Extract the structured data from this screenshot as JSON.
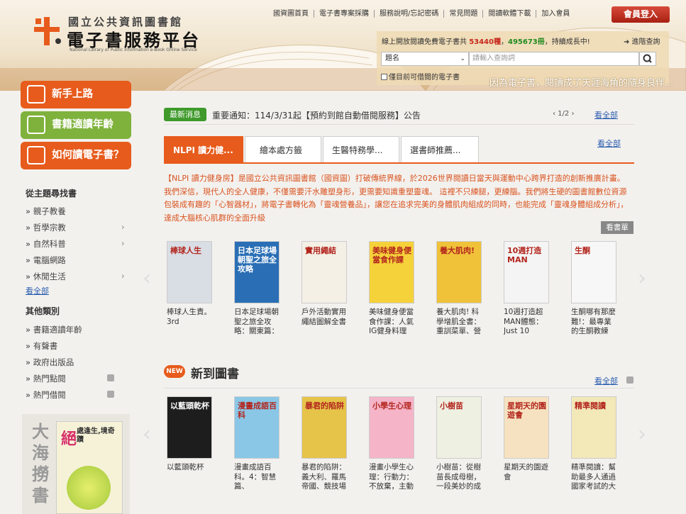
{
  "header": {
    "logo_line1": "國立公共資訊圖書館",
    "logo_line2": "電子書服務平台",
    "logo_en": "National Library of Public Information e-Book Online Service",
    "nav": [
      "國資圖首頁",
      "電子書專案採購",
      "服務說明/忘記密碼",
      "常見問題",
      "閱讀軟體下載",
      "加入會員"
    ],
    "member_login": "會員登入",
    "stat_prefix": "線上開放閱讀免費電子書共",
    "stat_titles": "53440種",
    "stat_sep": "，",
    "stat_volumes": "495673冊",
    "stat_suffix": "，持續成長中!",
    "advanced_search": "➜ 進階查詢",
    "search_field": "題名",
    "search_placeholder": "請輸入查詢詞",
    "borrowable_only": "僅目前可借閱的電子書",
    "slogan": "因為電子書，閱讀成了天涯海角的隨身良伴..."
  },
  "sidebar": {
    "beginner": "新手上路",
    "age_suitable": "書籍適讀年齡",
    "how_to_read": "如何讀電子書？",
    "topic_title": "從主題尋找書",
    "topics": [
      "親子教養",
      "哲學宗教",
      "自然科普",
      "電腦網路",
      "休閒生活"
    ],
    "see_all": "看全部",
    "other_title": "其他類別",
    "others": [
      "書籍適讀年齡",
      "有聲書",
      "政府出版品",
      "熱門點閱",
      "熱門借閱"
    ],
    "promo_big": "大海撈書",
    "promo_book_title1": "絕",
    "promo_book_title2": "處逢生,境奇蹟"
  },
  "news": {
    "tag": "最新消息",
    "text": "重要通知：114/3/31起【預約到館自動借閱服務】公告",
    "page": "‹  1/2  ›",
    "see_all": "看全部"
  },
  "tabs": {
    "items": [
      "NLPI 讀力健...",
      "繪本處方籤",
      "生醫特務學...",
      "選書師推薦..."
    ],
    "see_all": "看全部"
  },
  "feature": {
    "description": "【NLPI 讀力健身房】是國立公共資訊圖書館（國資圖）打破傳統界線，於2026世界閱讀日當天與運動中心跨界打造的創新推廣計畫。 我們深信，現代人的全人健康，不僅需要汗水雕塑身形，更需要知識重塑靈魂。 這裡不只練腿，更練腦。我們將生硬的圖書館數位資源包裝成有趣的「心智器材」，將電子書轉化為「靈魂營養品」，讓您在追求完美的身體肌肉組成的同時，也能完成「靈魂身體組成分析」，達成大腦核心肌群的全面升級",
    "read_more": "看書單",
    "books": [
      {
        "title": "棒球人生責。3rd",
        "cover": "棒球人生",
        "color": "#d9dde4"
      },
      {
        "title": "日本足球場朝聖之旅全攻略：關東篇：",
        "cover": "日本足球場朝聖之旅全攻略",
        "color": "#2a6fb5"
      },
      {
        "title": "戶外活動實用繩結圖解全書",
        "cover": "實用繩結",
        "color": "#f4f0e6"
      },
      {
        "title": "美味健身便當食作課：人氣IG健身料理",
        "cover": "美味健身便當食作課",
        "color": "#f6d23a"
      },
      {
        "title": "養大肌肉! 科學增肌全書：重訓菜單、營",
        "cover": "養大肌肉!",
        "color": "#f0c23a"
      },
      {
        "title": "10週打造超MAN體態：Just 10",
        "cover": "10週打造MAN",
        "color": "#f4f4f4"
      },
      {
        "title": "生酮哪有那麼難!：最專業的生酮教練",
        "cover": "生酮",
        "color": "#f7f7f7"
      }
    ]
  },
  "new_books": {
    "badge": "NEW",
    "title": "新到圖書",
    "see_all": "看全部",
    "books": [
      {
        "title": "以藍頭乾杯",
        "cover": "以藍頭乾杯",
        "color": "#1d1d1d"
      },
      {
        "title": "漫畫成語百科。4：智慧篇、",
        "cover": "漫畫成語百科",
        "color": "#8ac7e6"
      },
      {
        "title": "暴君的陷阱：義大利、羅馬帝國、競技場",
        "cover": "暴君的陷阱",
        "color": "#e6c44a"
      },
      {
        "title": "漫畫小學生心理：行動力：不放棄，主動",
        "cover": "小學生心理",
        "color": "#f5b4c8"
      },
      {
        "title": "小樹苗：從樹苗長成母樹，一段美妙的成",
        "cover": "小樹苗",
        "color": "#eef0e2"
      },
      {
        "title": "星期天的園遊會",
        "cover": "星期天的園遊會",
        "color": "#f6e2c0"
      },
      {
        "title": "精準閱讀：幫助最多人通過國家考試的大",
        "cover": "精準閱讀",
        "color": "#f2e8b8"
      }
    ]
  }
}
